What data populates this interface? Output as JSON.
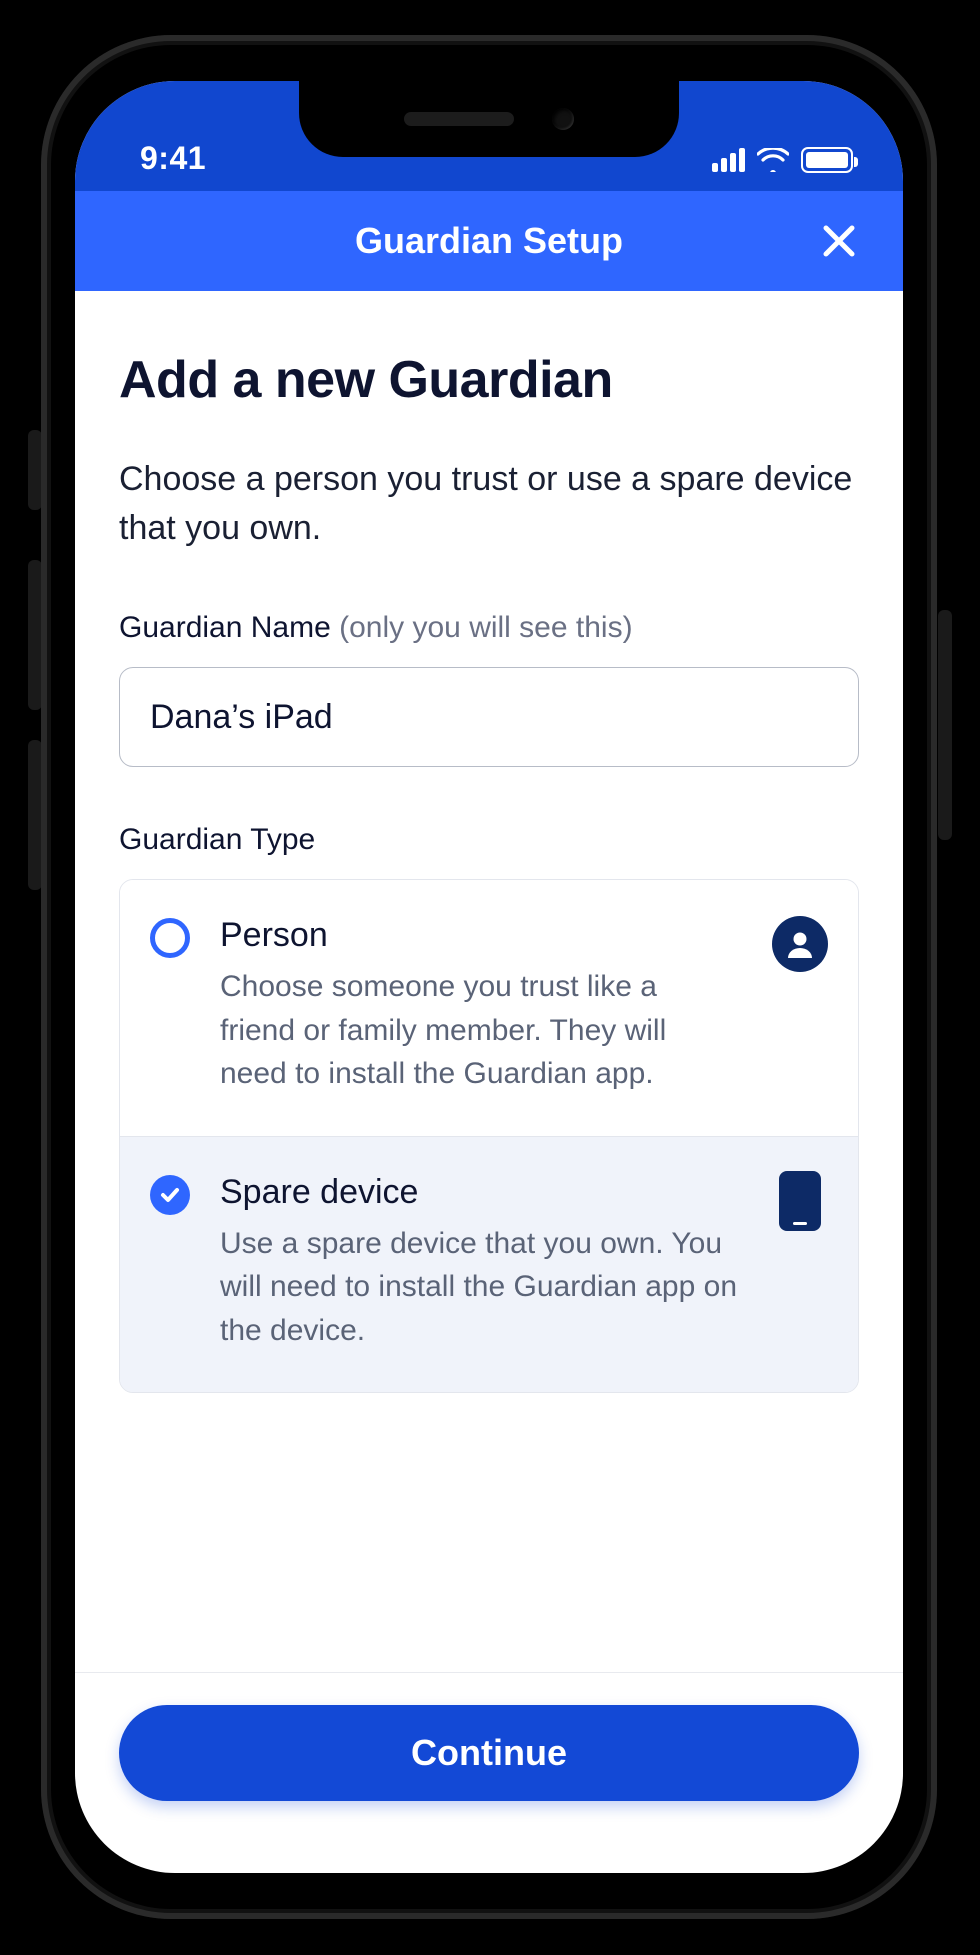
{
  "status_bar": {
    "time": "9:41",
    "signal_icon": "cellular-signal-icon",
    "wifi_icon": "wifi-icon",
    "battery_icon": "battery-full-icon"
  },
  "nav": {
    "title": "Guardian Setup",
    "close_icon": "close-x-icon"
  },
  "page": {
    "title": "Add a new Guardian",
    "subtitle": "Choose a person you trust or use a spare device that you own."
  },
  "name_field": {
    "label": "Guardian Name",
    "hint": "(only you will see this)",
    "value": "Dana’s iPad"
  },
  "type_field": {
    "label": "Guardian Type",
    "options": [
      {
        "id": "person",
        "title": "Person",
        "description": "Choose someone you trust like a friend or family member. They will need to install the Guardian app.",
        "icon": "person-circle-icon",
        "selected": false
      },
      {
        "id": "spare-device",
        "title": "Spare device",
        "description": "Use a spare device that you own. You will need to install the Guardian app on the device.",
        "icon": "smartphone-icon",
        "selected": true
      }
    ]
  },
  "footer": {
    "continue_label": "Continue"
  },
  "colors": {
    "primary": "#2f66ff",
    "primary_dark": "#1349d6",
    "status_bar_bg": "#1147cf",
    "navy_icon": "#0d2a66",
    "selected_bg": "#f0f3fa",
    "text": "#0e1430",
    "muted": "#5a6377"
  }
}
